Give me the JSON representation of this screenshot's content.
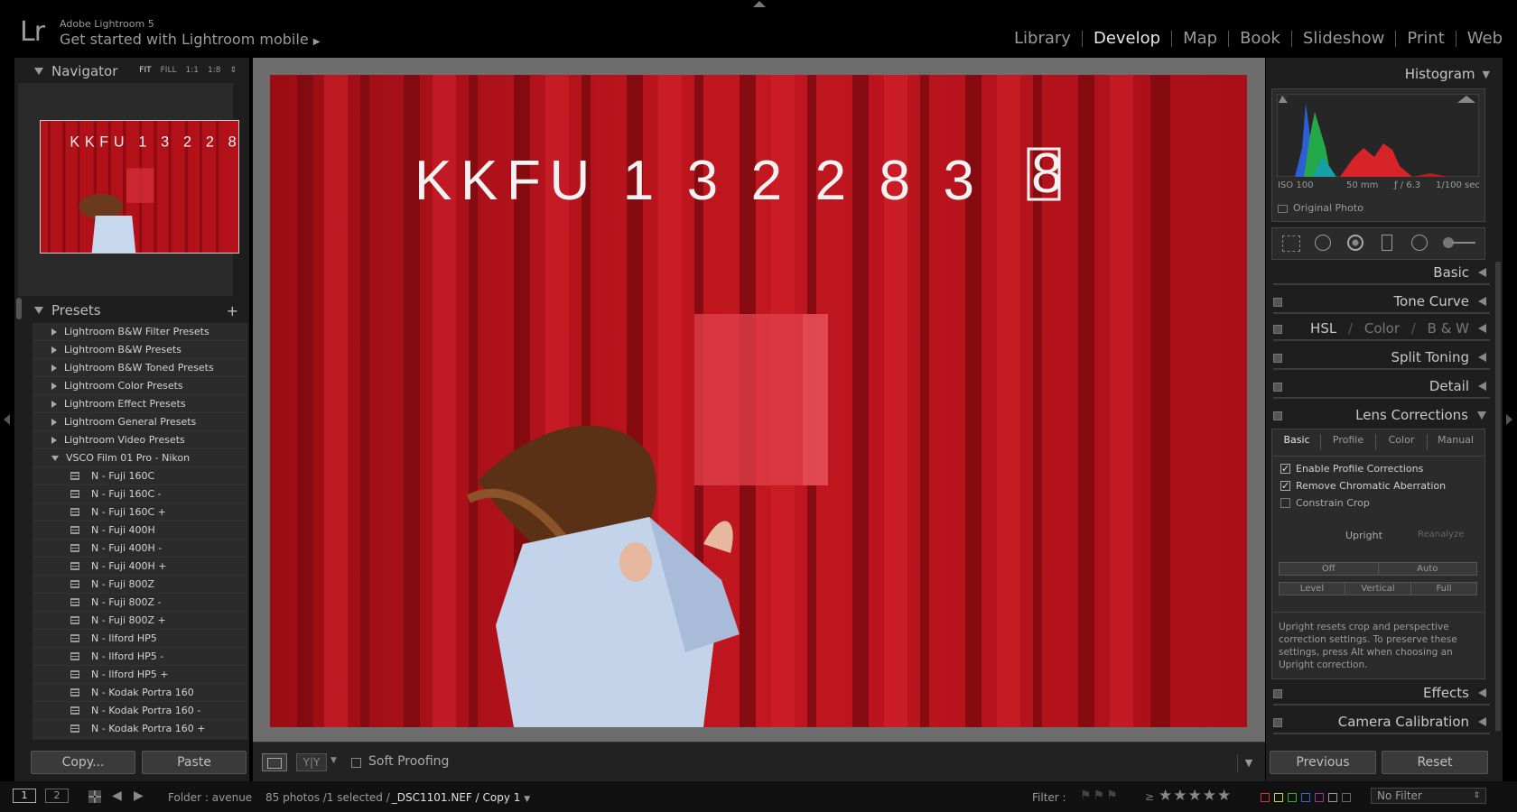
{
  "app": {
    "brand_small": "Adobe Lightroom 5",
    "brand_mobile": "Get started with Lightroom mobile",
    "logo": "Lr"
  },
  "modules": [
    "Library",
    "Develop",
    "Map",
    "Book",
    "Slideshow",
    "Print",
    "Web"
  ],
  "active_module": "Develop",
  "navigator": {
    "title": "Navigator",
    "zoom_options": [
      "FIT",
      "FILL",
      "1:1",
      "1:8"
    ],
    "active_zoom": "FIT"
  },
  "presets": {
    "title": "Presets",
    "add_icon": "plus-icon",
    "groups": [
      "Lightroom B&W Filter Presets",
      "Lightroom B&W Presets",
      "Lightroom B&W Toned Presets",
      "Lightroom Color Presets",
      "Lightroom Effect Presets",
      "Lightroom General Presets",
      "Lightroom Video Presets"
    ],
    "open_group": "VSCO Film 01 Pro - Nikon",
    "items": [
      "N - Fuji 160C",
      "N - Fuji 160C -",
      "N - Fuji 160C +",
      "N - Fuji 400H",
      "N - Fuji 400H -",
      "N - Fuji 400H +",
      "N - Fuji 800Z",
      "N - Fuji 800Z -",
      "N - Fuji 800Z +",
      "N - Ilford HP5",
      "N - Ilford HP5 -",
      "N - Ilford HP5 +",
      "N - Kodak Portra 160",
      "N - Kodak Portra 160 -",
      "N - Kodak Portra 160 +"
    ]
  },
  "left_buttons": {
    "copy": "Copy...",
    "paste": "Paste"
  },
  "photo": {
    "container_text": "KKFU 1 3 2 2 8 3",
    "box_digit": "8"
  },
  "toolbar": {
    "soft_proofing": "Soft Proofing"
  },
  "histogram": {
    "title": "Histogram",
    "iso": "ISO 100",
    "focal": "50 mm",
    "aperture": "ƒ / 6.3",
    "shutter": "1/100 sec",
    "original_photo": "Original Photo"
  },
  "panels": {
    "basic": "Basic",
    "tone_curve": "Tone Curve",
    "hsl": "HSL",
    "color": "Color",
    "bw": "B & W",
    "slash": "/",
    "split_toning": "Split Toning",
    "detail": "Detail",
    "lens_corrections": "Lens Corrections",
    "effects": "Effects",
    "camera_calibration": "Camera Calibration"
  },
  "lens": {
    "tabs": [
      "Basic",
      "Profile",
      "Color",
      "Manual"
    ],
    "active_tab": "Basic",
    "enable_profile": "Enable Profile Corrections",
    "remove_ca": "Remove Chromatic Aberration",
    "constrain_crop": "Constrain Crop",
    "enable_profile_checked": true,
    "remove_ca_checked": true,
    "constrain_crop_checked": false,
    "upright": "Upright",
    "reanalyze": "Reanalyze",
    "upright_buttons_row1": [
      "Off",
      "Auto"
    ],
    "upright_buttons_row2": [
      "Level",
      "Vertical",
      "Full"
    ],
    "note": "Upright resets crop and perspective correction settings. To preserve these settings, press Alt when choosing an Upright correction."
  },
  "right_buttons": {
    "previous": "Previous",
    "reset": "Reset"
  },
  "filmstrip": {
    "view1": "1",
    "view2": "2",
    "folder": "Folder : avenue",
    "count": "85 photos /1 selected /",
    "filename": "_DSC1101.NEF / Copy 1",
    "filter_label": "Filter :",
    "gte": "≥",
    "no_filter": "No Filter"
  },
  "colors": {
    "accent_text": "#e8e8e8",
    "panel_bg": "#1e1e1e",
    "container_red": "#b5121b"
  }
}
